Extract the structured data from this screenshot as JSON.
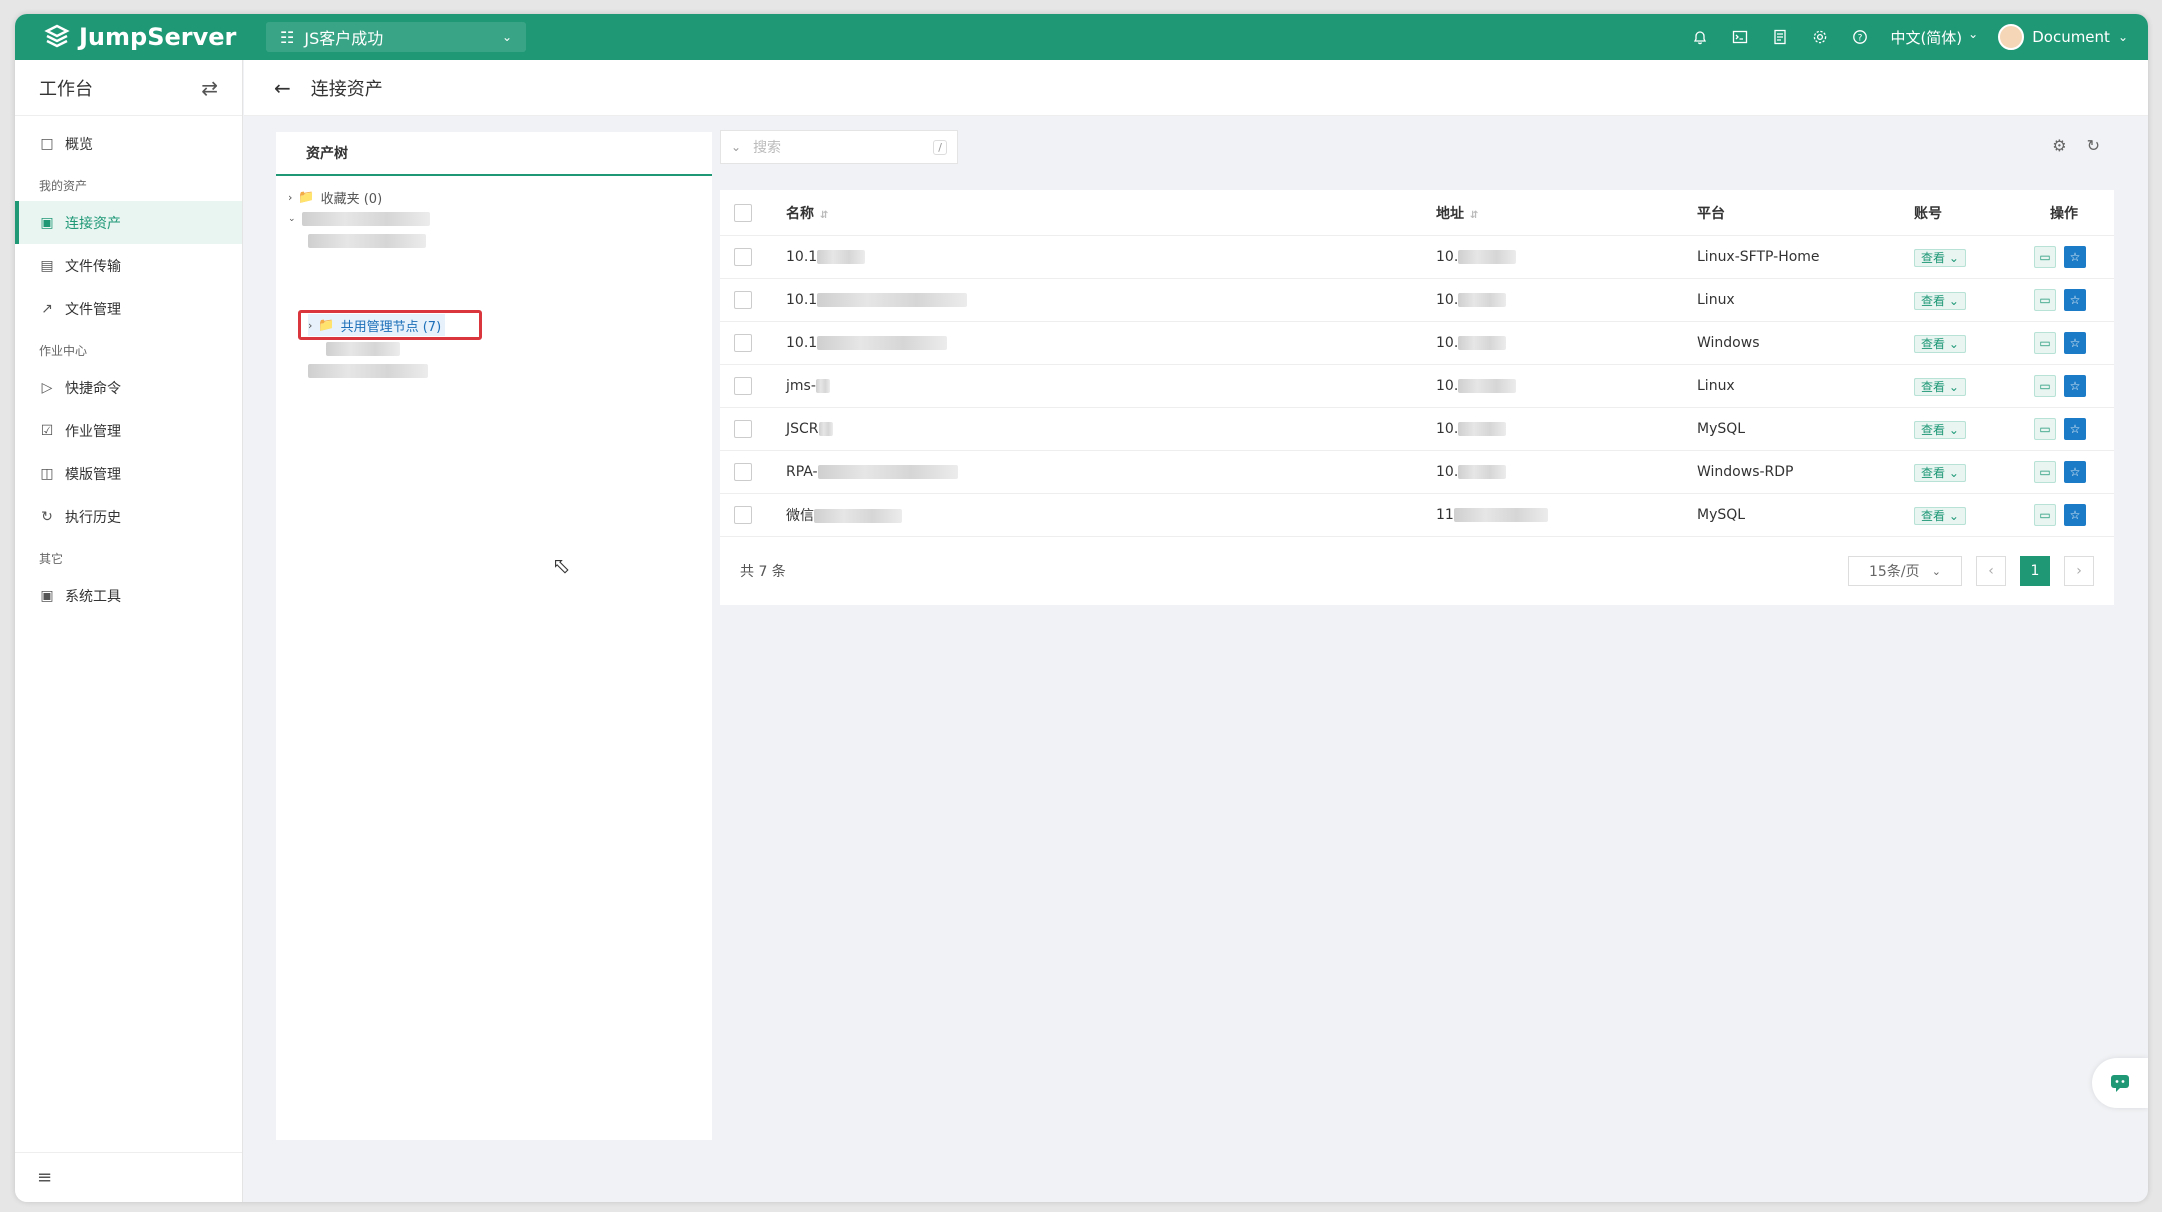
{
  "topbar": {
    "brand": "JumpServer",
    "org": "JS客户成功",
    "language": "中文(简体)",
    "user": "Document",
    "colors": {
      "accent": "#1f9876"
    }
  },
  "sidebar": {
    "title": "工作台",
    "sections": [
      {
        "label": "",
        "items": [
          {
            "label": "概览",
            "icon": "monitor-icon"
          }
        ]
      },
      {
        "label": "我的资产",
        "items": [
          {
            "label": "连接资产",
            "icon": "desktop-icon",
            "active": true
          },
          {
            "label": "文件传输",
            "icon": "file-transfer-icon"
          },
          {
            "label": "文件管理",
            "icon": "external-link-icon"
          }
        ]
      },
      {
        "label": "作业中心",
        "items": [
          {
            "label": "快捷命令",
            "icon": "play-circle-icon"
          },
          {
            "label": "作业管理",
            "icon": "clipboard-check-icon"
          },
          {
            "label": "模版管理",
            "icon": "template-icon"
          },
          {
            "label": "执行历史",
            "icon": "history-icon"
          }
        ]
      },
      {
        "label": "其它",
        "items": [
          {
            "label": "系统工具",
            "icon": "toolbox-icon"
          }
        ]
      }
    ]
  },
  "page": {
    "title": "连接资产"
  },
  "tree": {
    "tab": "资产树",
    "favorites": "收藏夹 (0)",
    "shared_node": "共用管理节点 (7)"
  },
  "search": {
    "placeholder": "搜索",
    "shortcut": "/"
  },
  "table": {
    "headers": {
      "name": "名称",
      "address": "地址",
      "platform": "平台",
      "account": "账号",
      "action": "操作"
    },
    "view_label": "查看",
    "rows": [
      {
        "name": "10.1",
        "address": "10.",
        "platform": "Linux-SFTP-Home"
      },
      {
        "name": "10.1",
        "address": "10.",
        "platform": "Linux"
      },
      {
        "name": "10.1",
        "address": "10.",
        "platform": "Windows"
      },
      {
        "name": "jms-",
        "address": "10.",
        "platform": "Linux"
      },
      {
        "name": "JSCR",
        "address": "10.",
        "platform": "MySQL"
      },
      {
        "name": "RPA-",
        "address": "10.",
        "platform": "Windows-RDP"
      },
      {
        "name": "微信",
        "address": "11",
        "platform": "MySQL"
      }
    ]
  },
  "pager": {
    "total": "共 7 条",
    "page_size": "15条/页",
    "current": "1"
  }
}
